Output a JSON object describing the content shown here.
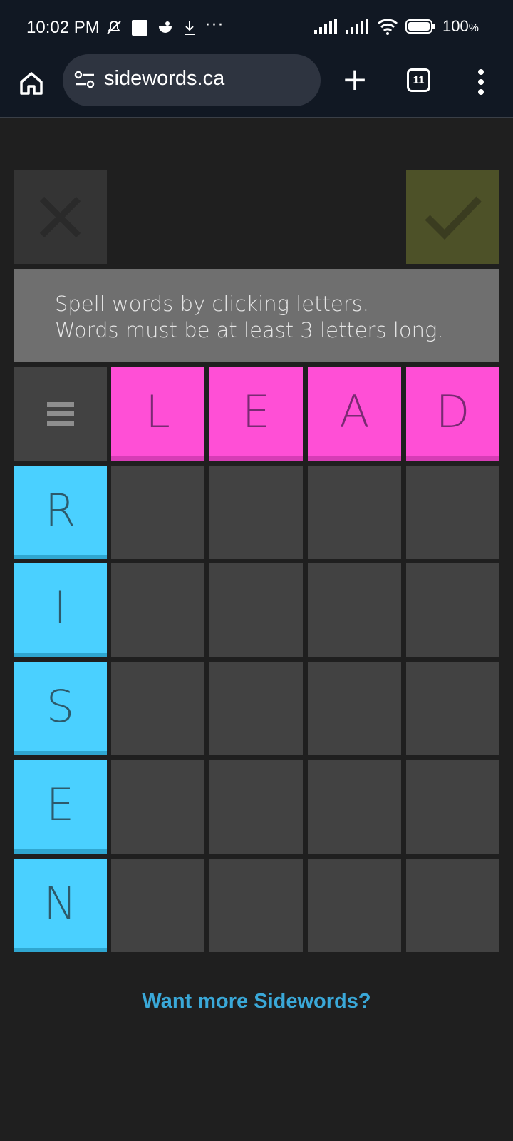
{
  "status_bar": {
    "time": "10:02 PM",
    "battery": "100",
    "icons": [
      "mute-icon",
      "square-icon",
      "app-icon",
      "download-icon",
      "more-dots-icon",
      "signal-icon",
      "signal-icon",
      "wifi-icon",
      "battery-icon"
    ]
  },
  "browser": {
    "url": "sidewords.ca",
    "tab_count": "11"
  },
  "game": {
    "message_line1": "Spell words by clicking letters.",
    "message_line2": "Words must be at least 3 letters long.",
    "top_word": [
      "L",
      "E",
      "A",
      "D"
    ],
    "side_word": [
      "R",
      "I",
      "S",
      "E",
      "N"
    ],
    "colors": {
      "top": "#ff4fd6",
      "side": "#4ad0ff",
      "cell": "#424242",
      "check": "#4d5128"
    }
  },
  "footer": {
    "link": "Want more Sidewords?"
  }
}
